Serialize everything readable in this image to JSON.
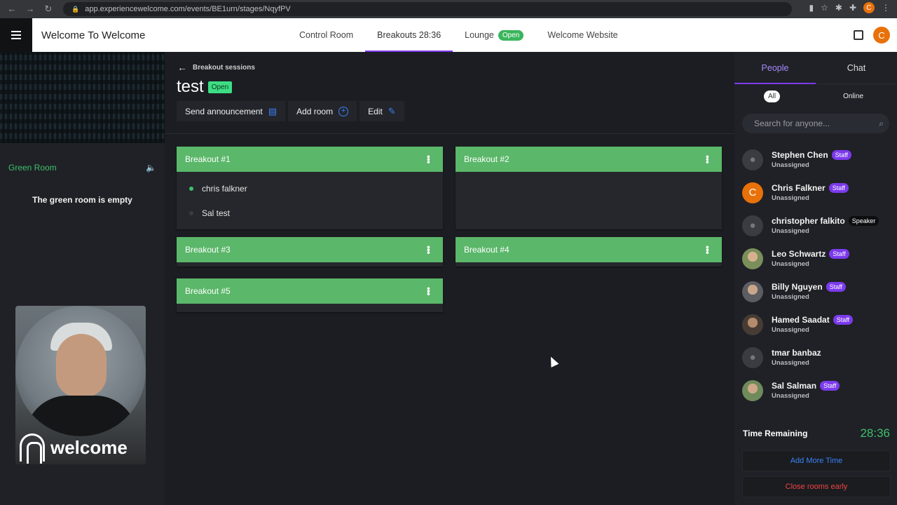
{
  "browser": {
    "url": "app.experiencewelcome.com/events/BE1urn/stages/NqyfPV",
    "profile_initial": "C"
  },
  "header": {
    "title": "Welcome To Welcome",
    "tabs": [
      {
        "label": "Control Room"
      },
      {
        "label": "Breakouts 28:36"
      },
      {
        "label": "Lounge",
        "badge": "Open"
      },
      {
        "label": "Welcome Website"
      }
    ],
    "avatar_initial": "C"
  },
  "left": {
    "green_room_label": "Green Room",
    "empty_text": "The green room is empty",
    "video_brand": "welcome"
  },
  "main": {
    "back_label": "Breakout sessions",
    "session_name": "test",
    "session_status": "Open",
    "actions": {
      "announce": "Send announcement",
      "add_room": "Add room",
      "edit": "Edit"
    },
    "rooms": [
      {
        "name": "Breakout #1",
        "members": [
          {
            "name": "chris falkner",
            "status_color": "#3ec06c"
          },
          {
            "name": "Sal test",
            "status_color": "#3a3c42"
          }
        ]
      },
      {
        "name": "Breakout #2",
        "members": []
      },
      {
        "name": "Breakout #3",
        "members": []
      },
      {
        "name": "Breakout #4",
        "members": []
      },
      {
        "name": "Breakout #5",
        "members": []
      }
    ]
  },
  "right": {
    "tabs": {
      "people": "People",
      "chat": "Chat"
    },
    "filters": {
      "all": "All",
      "online": "Online"
    },
    "search_placeholder": "Search for anyone...",
    "people": [
      {
        "name": "Stephen Chen",
        "status": "Unassigned",
        "tag": "Staff"
      },
      {
        "name": "Chris Falkner",
        "status": "Unassigned",
        "tag": "Staff",
        "initial": "C"
      },
      {
        "name": "christopher falkito",
        "status": "Unassigned",
        "tag": "Speaker"
      },
      {
        "name": "Leo Schwartz",
        "status": "Unassigned",
        "tag": "Staff"
      },
      {
        "name": "Billy Nguyen",
        "status": "Unassigned",
        "tag": "Staff"
      },
      {
        "name": "Hamed Saadat",
        "status": "Unassigned",
        "tag": "Staff"
      },
      {
        "name": "tmar banbaz",
        "status": "Unassigned"
      },
      {
        "name": "Sal Salman",
        "status": "Unassigned",
        "tag": "Staff"
      }
    ],
    "time_label": "Time Remaining",
    "time_value": "28:36",
    "add_time": "Add More Time",
    "close_early": "Close rooms early"
  },
  "colors": {
    "accent_purple": "#7c3aed",
    "green": "#3ec06c",
    "room_header": "#5bb76a",
    "link_blue": "#3b82f6",
    "danger_red": "#ef4444"
  }
}
